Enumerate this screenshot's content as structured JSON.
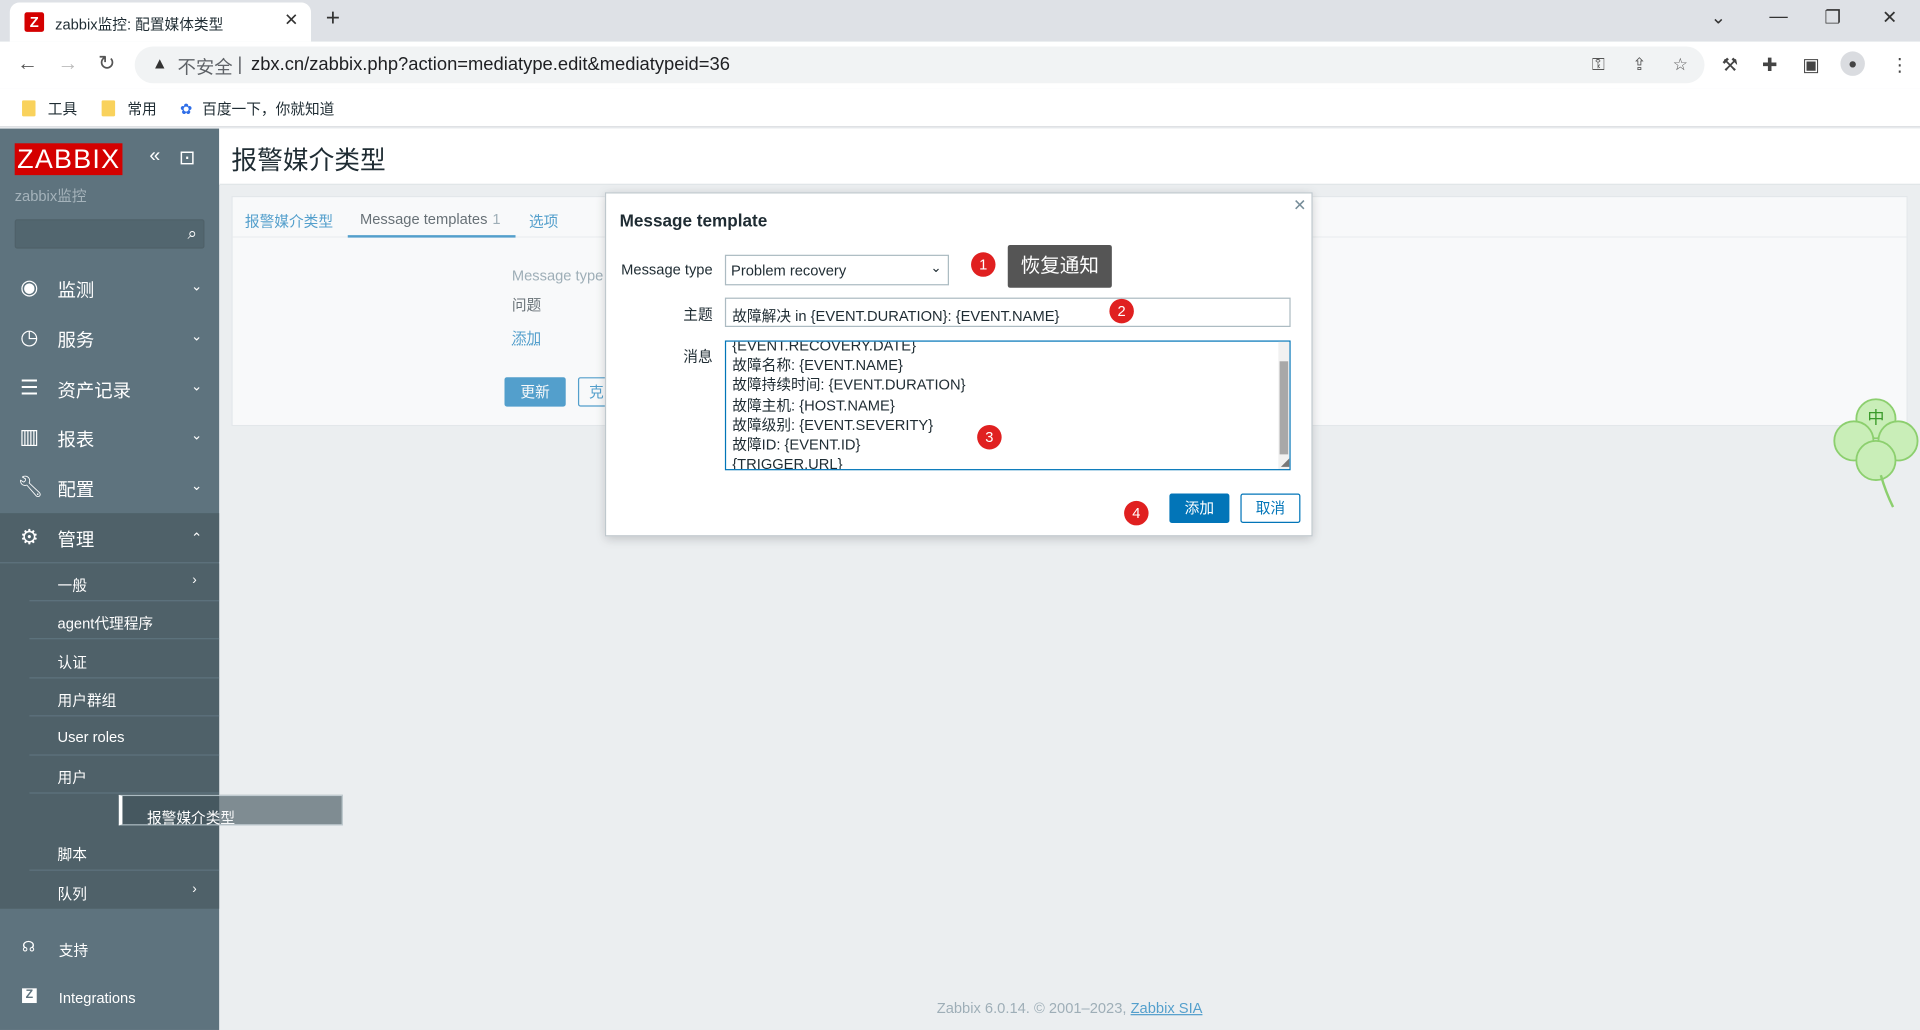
{
  "browser": {
    "tab_title": "zabbix监控: 配置媒体类型",
    "security_label": "不安全",
    "url": "zbx.cn/zabbix.php?action=mediatype.edit&mediatypeid=36",
    "bookmarks": [
      "工具",
      "常用",
      "百度一下，你就知道"
    ]
  },
  "sidebar": {
    "logo": "ZABBIX",
    "server_name": "zabbix监控",
    "menu": [
      {
        "label": "监测",
        "icon": "eye-icon"
      },
      {
        "label": "服务",
        "icon": "stopwatch-icon"
      },
      {
        "label": "资产记录",
        "icon": "list-icon"
      },
      {
        "label": "报表",
        "icon": "bar-chart-icon"
      },
      {
        "label": "配置",
        "icon": "wrench-icon"
      },
      {
        "label": "管理",
        "icon": "gear-icon"
      }
    ],
    "admin_items": [
      "一般",
      "agent代理程序",
      "认证",
      "用户群组",
      "User roles",
      "用户",
      "报警媒介类型",
      "脚本",
      "队列"
    ],
    "bottom": [
      {
        "label": "支持",
        "icon": "headset-icon"
      },
      {
        "label": "Integrations",
        "icon": "zabbix-z-icon"
      }
    ]
  },
  "page": {
    "title": "报警媒介类型",
    "tabs": [
      {
        "label": "报警媒介类型"
      },
      {
        "label": "Message templates",
        "count": "1"
      },
      {
        "label": "选项"
      }
    ],
    "table_header": "Message type",
    "table_row": "问题",
    "add_link": "添加",
    "update_button": "更新",
    "clone_button": "克"
  },
  "dialog": {
    "title": "Message template",
    "message_type_label": "Message type",
    "message_type_value": "Problem recovery",
    "subject_label": "主题",
    "subject_value": "故障解决 in {EVENT.DURATION}: {EVENT.NAME}",
    "message_label": "消息",
    "message_lines": [
      "{EVENT.RECOVERY.DATE}",
      "故障名称: {EVENT.NAME}",
      "故障持续时间: {EVENT.DURATION}",
      "故障主机: {HOST.NAME}",
      "故障级别: {EVENT.SEVERITY}",
      "故障ID: {EVENT.ID}",
      "{TRIGGER.URL}"
    ],
    "add_button": "添加",
    "cancel_button": "取消"
  },
  "annotations": {
    "badges": [
      "1",
      "2",
      "3",
      "4"
    ],
    "tooltip": "恢复通知"
  },
  "ime_label": "中",
  "footer": {
    "text": "Zabbix 6.0.14. © 2001–2023, ",
    "link": "Zabbix SIA"
  },
  "colors": {
    "zabbix_red": "#d40000",
    "sidebar_bg": "#5e737e",
    "link_blue": "#0275b8",
    "badge_red": "#e02020"
  }
}
